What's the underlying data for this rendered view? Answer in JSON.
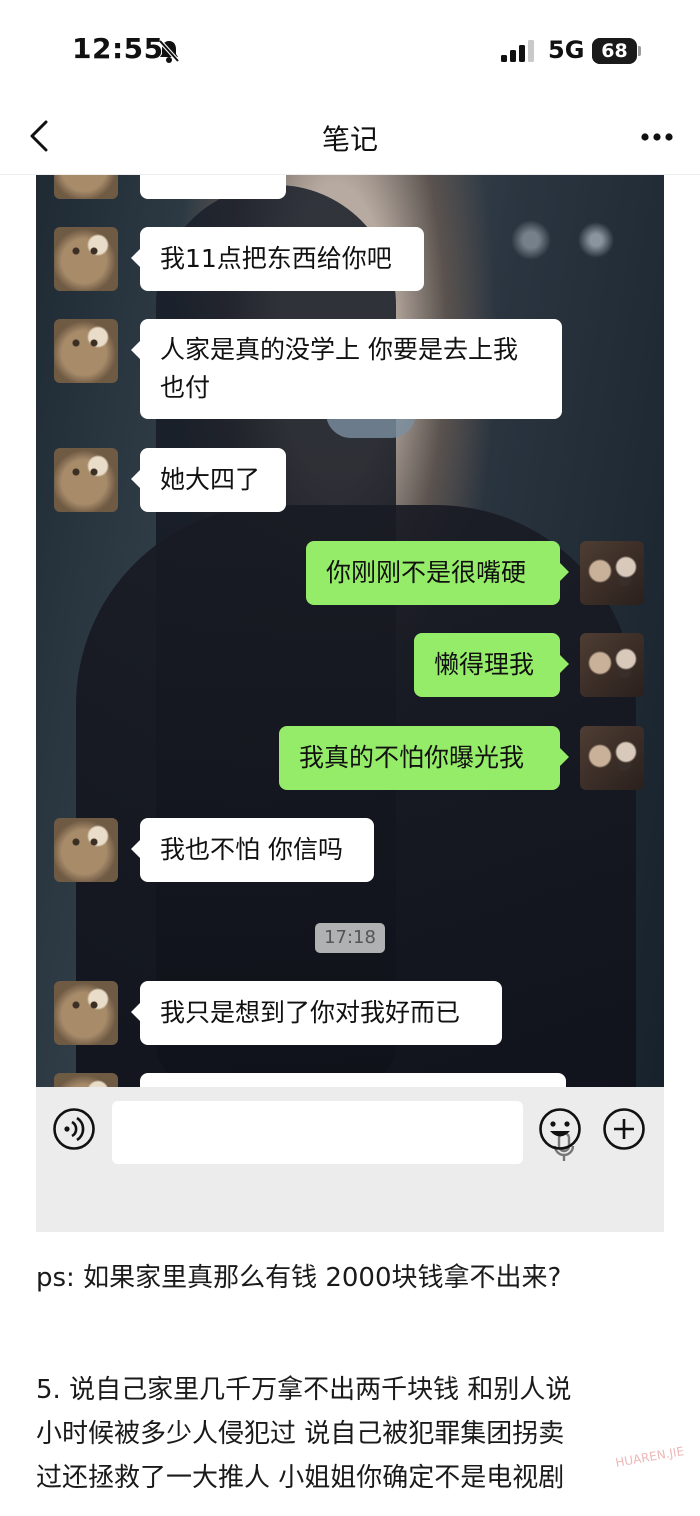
{
  "status_bar": {
    "time": "12:55",
    "network": "5G",
    "battery": {
      "percent_text": "68",
      "level": 0.68
    }
  },
  "nav": {
    "title": "笔记"
  },
  "chat": {
    "messages": [
      {
        "side": "left",
        "text": "我11点把东西给你吧"
      },
      {
        "side": "left",
        "text": "人家是真的没学上 你要是去上我",
        "text2": "也付"
      },
      {
        "side": "left",
        "text": "她大四了"
      },
      {
        "side": "right",
        "text": "你刚刚不是很嘴硬"
      },
      {
        "side": "right",
        "text": "懒得理我"
      },
      {
        "side": "right",
        "text": "我真的不怕你曝光我"
      },
      {
        "side": "left",
        "text": "我也不怕 你信吗"
      },
      {
        "side": "left",
        "text": "我只是想到了你对我好而已"
      }
    ],
    "timestamp": "17:18"
  },
  "article": {
    "ps_line": "ps: 如果家里真那么有钱 2000块钱拿不出来?",
    "point5_lines": [
      "5.  说自己家里几千万拿不出两千块钱 和别人说",
      "小时候被多少人侵犯过 说自己被犯罪集团拐卖",
      "过还拯救了一大推人 小姐姐你确定不是电视剧"
    ]
  },
  "watermark": "HUAREN.JIE",
  "colors": {
    "green_bubble": "#95ec69",
    "white_bubble": "#ffffff"
  }
}
